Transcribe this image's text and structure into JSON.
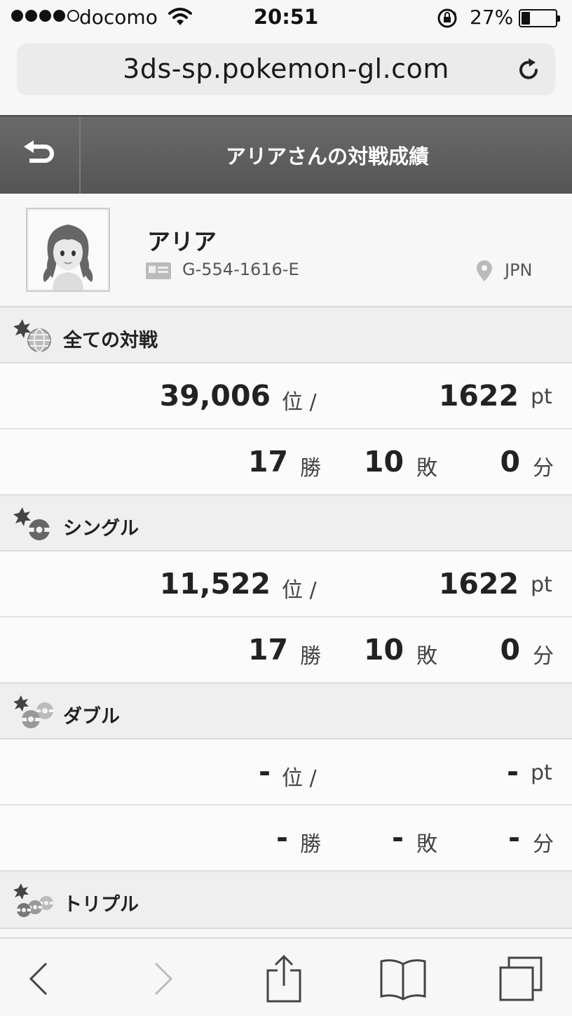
{
  "status_bar": {
    "carrier": "docomo",
    "time": "20:51",
    "battery": "27%",
    "battery_level": 0.27,
    "signal_bars": 4
  },
  "browser": {
    "url": "3ds-sp.pokemon-gl.com"
  },
  "header": {
    "title": "アリアさんの対戦成績"
  },
  "profile": {
    "name": "アリア",
    "player_id": "G-554-1616-E",
    "country": "JPN"
  },
  "sections": [
    {
      "label": "全ての対戦",
      "icon": "globe-icon",
      "rank": "39,006",
      "rank_unit": "位 /",
      "points": "1622",
      "points_unit": "pt",
      "wins": "17",
      "wins_unit": "勝",
      "losses": "10",
      "losses_unit": "敗",
      "draws": "0",
      "draws_unit": "分"
    },
    {
      "label": "シングル",
      "icon": "single-ball-icon",
      "rank": "11,522",
      "rank_unit": "位 /",
      "points": "1622",
      "points_unit": "pt",
      "wins": "17",
      "wins_unit": "勝",
      "losses": "10",
      "losses_unit": "敗",
      "draws": "0",
      "draws_unit": "分"
    },
    {
      "label": "ダブル",
      "icon": "double-ball-icon",
      "rank": "-",
      "rank_unit": "位 /",
      "points": "-",
      "points_unit": "pt",
      "wins": "-",
      "wins_unit": "勝",
      "losses": "-",
      "losses_unit": "敗",
      "draws": "-",
      "draws_unit": "分"
    },
    {
      "label": "トリプル",
      "icon": "triple-ball-icon"
    }
  ],
  "toolbar": {
    "items": [
      "back-icon",
      "forward-icon",
      "share-icon",
      "bookmarks-icon",
      "tabs-icon"
    ]
  }
}
